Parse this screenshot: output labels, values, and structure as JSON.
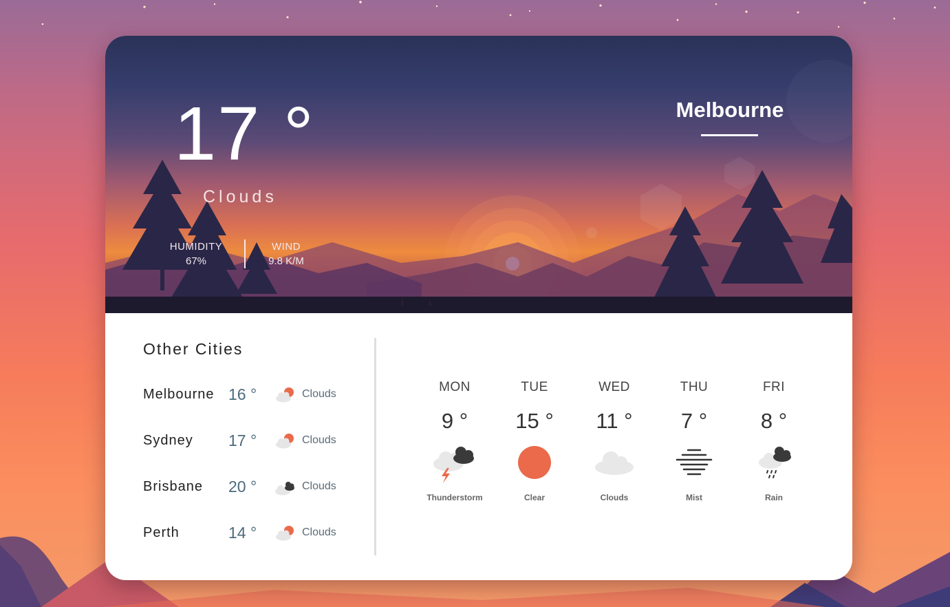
{
  "current": {
    "temperature": "17 °",
    "condition": "Clouds",
    "humidity_label": "HUMIDITY",
    "humidity_value": "67%",
    "wind_label": "WIND",
    "wind_value": "9.8 K/M",
    "city": "Melbourne"
  },
  "other_cities": {
    "title": "Other Cities",
    "items": [
      {
        "name": "Melbourne",
        "temp": "16 °",
        "condition": "Clouds",
        "icon": "cloud-sun-icon"
      },
      {
        "name": "Sydney",
        "temp": "17 °",
        "condition": "Clouds",
        "icon": "cloud-sun-icon"
      },
      {
        "name": "Brisbane",
        "temp": "20 °",
        "condition": "Clouds",
        "icon": "dark-clouds-icon"
      },
      {
        "name": "Perth",
        "temp": "14 °",
        "condition": "Clouds",
        "icon": "cloud-sun-icon"
      }
    ]
  },
  "forecast": [
    {
      "day": "MON",
      "temp": "9 °",
      "condition": "Thunderstorm",
      "icon": "thunderstorm-icon"
    },
    {
      "day": "TUE",
      "temp": "15 °",
      "condition": "Clear",
      "icon": "sun-icon"
    },
    {
      "day": "WED",
      "temp": "11 °",
      "condition": "Clouds",
      "icon": "cloud-icon"
    },
    {
      "day": "THU",
      "temp": "7 °",
      "condition": "Mist",
      "icon": "mist-icon"
    },
    {
      "day": "FRI",
      "temp": "8 °",
      "condition": "Rain",
      "icon": "rain-icon"
    }
  ],
  "colors": {
    "accent_sun": "#ea6a4b",
    "temp_text": "#4d6a7d",
    "cloud_grey": "#e3e3e3",
    "dark_cloud": "#3a3a3a"
  }
}
